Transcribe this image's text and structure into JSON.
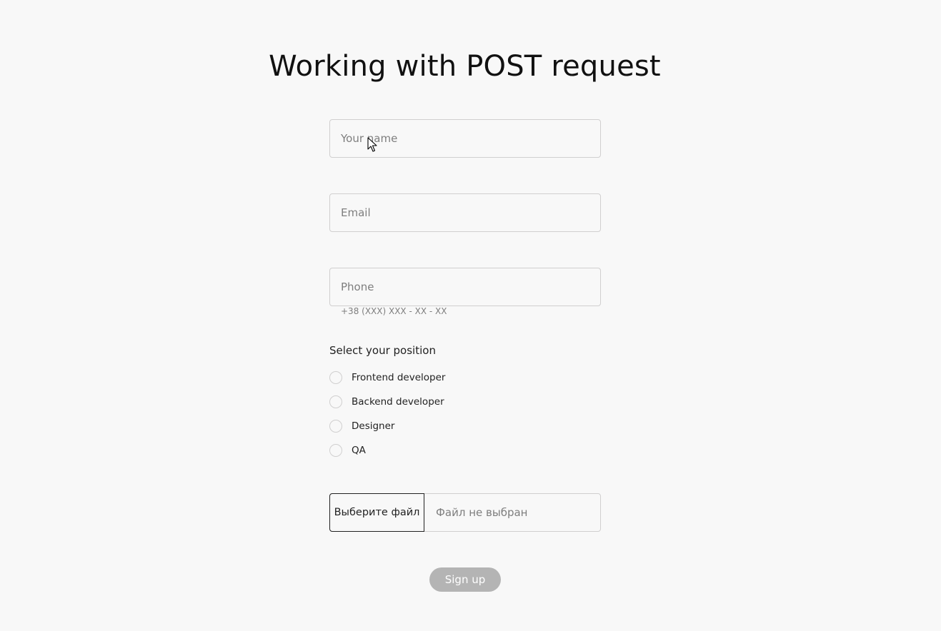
{
  "page": {
    "title": "Working with POST request"
  },
  "form": {
    "name_placeholder": "Your name",
    "email_placeholder": "Email",
    "phone_placeholder": "Phone",
    "phone_helper": "+38 (XXX) XXX - XX - XX",
    "position_label": "Select your position",
    "positions": [
      {
        "label": "Frontend developer",
        "selected": false
      },
      {
        "label": "Backend developer",
        "selected": false
      },
      {
        "label": "Designer",
        "selected": false
      },
      {
        "label": "QA",
        "selected": false
      }
    ],
    "upload_button": "Выберите файл",
    "upload_status": "Файл не выбран",
    "submit_label": "Sign up"
  },
  "colors": {
    "background": "#f8f8f8",
    "border": "#d0cfcf",
    "submit_disabled": "#b4b4b4",
    "placeholder": "#7e7e7e"
  }
}
